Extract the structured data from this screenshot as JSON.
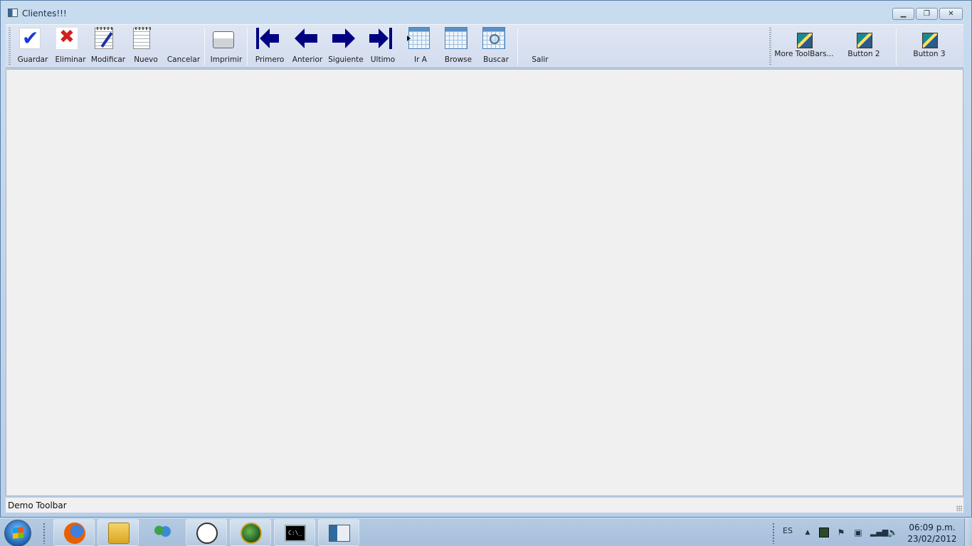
{
  "window": {
    "title": "Clientes!!!"
  },
  "toolbar": {
    "buttons": [
      {
        "label": "Guardar",
        "icon": "check-icon"
      },
      {
        "label": "Eliminar",
        "icon": "delete-x-icon"
      },
      {
        "label": "Modificar",
        "icon": "edit-notepad-icon"
      },
      {
        "label": "Nuevo",
        "icon": "new-notepad-icon"
      },
      {
        "label": "Cancelar",
        "icon": ""
      },
      {
        "label": "Imprimir",
        "icon": "printer-icon"
      },
      {
        "label": "Primero",
        "icon": "first-arrow-icon"
      },
      {
        "label": "Anterior",
        "icon": "previous-arrow-icon"
      },
      {
        "label": "Siguiente",
        "icon": "next-arrow-icon"
      },
      {
        "label": "Ultimo",
        "icon": "last-arrow-icon"
      },
      {
        "label": "Ir A",
        "icon": "goto-grid-icon"
      },
      {
        "label": "Browse",
        "icon": "browse-grid-icon"
      },
      {
        "label": "Buscar",
        "icon": "search-grid-icon"
      },
      {
        "label": "Salir",
        "icon": ""
      }
    ],
    "extra": [
      {
        "label": "More ToolBars..."
      },
      {
        "label": "Button 2"
      },
      {
        "label": "Button 3"
      }
    ],
    "arrow_color": "#000080"
  },
  "statusbar": {
    "text": "Demo Toolbar"
  },
  "taskbar": {
    "language": "ES",
    "time": "06:09 p.m.",
    "date": "23/02/2012",
    "apps": [
      "firefox-icon",
      "explorer-folder-icon",
      "messenger-icon",
      "rabbit-app-icon",
      "globe-app-icon",
      "cmd-icon",
      "window-app-icon"
    ]
  }
}
